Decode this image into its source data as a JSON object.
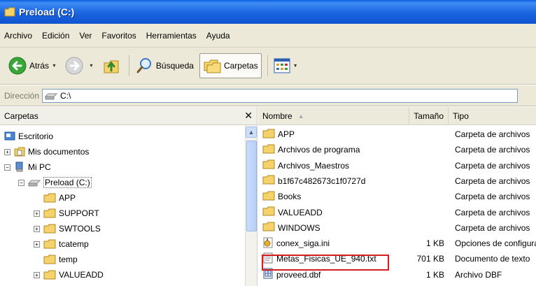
{
  "window": {
    "title": "Preload (C:)"
  },
  "menu": [
    "Archivo",
    "Edición",
    "Ver",
    "Favoritos",
    "Herramientas",
    "Ayuda"
  ],
  "toolbar": {
    "back_label": "Atrás",
    "search_label": "Búsqueda",
    "folders_label": "Carpetas"
  },
  "address": {
    "label": "Dirección",
    "value": "C:\\"
  },
  "folders_pane": {
    "title": "Carpetas",
    "tree": [
      {
        "label": "Escritorio",
        "expander": ""
      },
      {
        "label": "Mis documentos",
        "expander": "+"
      },
      {
        "label": "Mi PC",
        "expander": "−"
      },
      {
        "label": "Preload (C:)",
        "expander": "−"
      },
      {
        "label": "APP",
        "expander": ""
      },
      {
        "label": "SUPPORT",
        "expander": "+"
      },
      {
        "label": "SWTOOLS",
        "expander": "+"
      },
      {
        "label": "tcatemp",
        "expander": "+"
      },
      {
        "label": "temp",
        "expander": ""
      },
      {
        "label": "VALUEADD",
        "expander": "+"
      }
    ]
  },
  "file_list": {
    "columns": {
      "name": "Nombre",
      "size": "Tamaño",
      "type": "Tipo"
    },
    "rows": [
      {
        "name": "APP",
        "size": "",
        "type": "Carpeta de archivos",
        "icon": "folder-icon"
      },
      {
        "name": "Archivos de programa",
        "size": "",
        "type": "Carpeta de archivos",
        "icon": "folder-icon"
      },
      {
        "name": "Archivos_Maestros",
        "size": "",
        "type": "Carpeta de archivos",
        "icon": "folder-icon"
      },
      {
        "name": "b1f67c482673c1f0727d",
        "size": "",
        "type": "Carpeta de archivos",
        "icon": "folder-icon"
      },
      {
        "name": "Books",
        "size": "",
        "type": "Carpeta de archivos",
        "icon": "folder-icon"
      },
      {
        "name": "VALUEADD",
        "size": "",
        "type": "Carpeta de archivos",
        "icon": "folder-icon"
      },
      {
        "name": "WINDOWS",
        "size": "",
        "type": "Carpeta de archivos",
        "icon": "folder-icon"
      },
      {
        "name": "conex_siga.ini",
        "size": "1 KB",
        "type": "Opciones de configuración",
        "icon": "ini-file-icon"
      },
      {
        "name": "Metas_Fisicas_UE_940.txt",
        "size": "701 KB",
        "type": "Documento de texto",
        "icon": "text-file-icon"
      },
      {
        "name": "proveed.dbf",
        "size": "1 KB",
        "type": "Archivo DBF",
        "icon": "dbf-file-icon"
      }
    ]
  },
  "colors": {
    "title_bar": "#1a64e0",
    "highlight_box": "#d22020",
    "folder_yellow": "#f5d36a"
  }
}
